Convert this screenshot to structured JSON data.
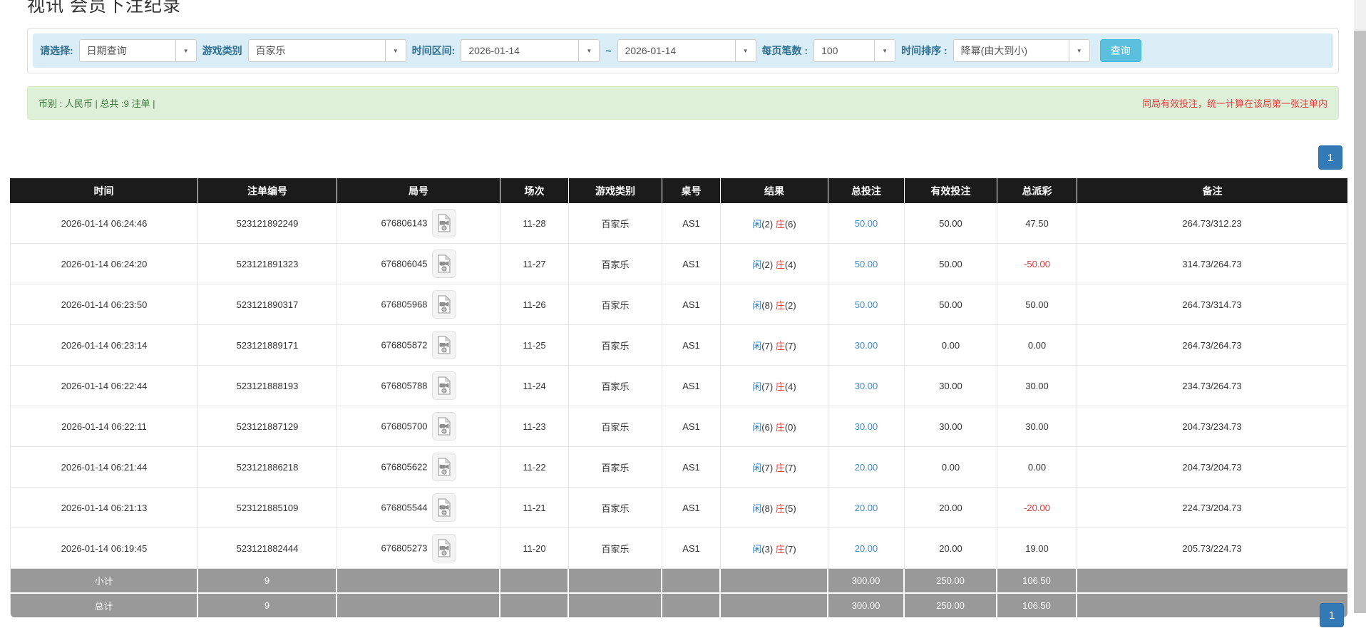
{
  "page": {
    "title": "视讯 会员下注纪录"
  },
  "filters": {
    "select_label": "请选择:",
    "select_value": "日期查询",
    "game_label": "游戏类别",
    "game_value": "百家乐",
    "range_label": "时间区间:",
    "date_from": "2026-01-14",
    "date_to": "2026-01-14",
    "tilde": "~",
    "per_page_label": "每页笔数 :",
    "per_page_value": "100",
    "sort_label": "时间排序 :",
    "sort_value": "降幂(由大到小)",
    "search_button": "查询"
  },
  "summary": {
    "left": "币别 : 人民币 | 总共 :9 注单 |",
    "right": "同局有效投注，统一计算在该局第一张注单内"
  },
  "pagination": {
    "page": "1"
  },
  "table": {
    "headers": [
      "时间",
      "注单编号",
      "局号",
      "场次",
      "游戏类别",
      "桌号",
      "结果",
      "总投注",
      "有效投注",
      "总派彩",
      "备注"
    ],
    "rows": [
      {
        "time": "2026-01-14 06:24:46",
        "bet_id": "523121892249",
        "round": "676806143",
        "session": "11-28",
        "game": "百家乐",
        "table_no": "AS1",
        "player_label": "闲",
        "player_score": "(2)",
        "banker_label": "庄",
        "banker_score": "(6)",
        "total_bet": "50.00",
        "valid_bet": "50.00",
        "payout": "47.50",
        "note": "264.73/312.23"
      },
      {
        "time": "2026-01-14 06:24:20",
        "bet_id": "523121891323",
        "round": "676806045",
        "session": "11-27",
        "game": "百家乐",
        "table_no": "AS1",
        "player_label": "闲",
        "player_score": "(2)",
        "banker_label": "庄",
        "banker_score": "(4)",
        "total_bet": "50.00",
        "valid_bet": "50.00",
        "payout": "-50.00",
        "note": "314.73/264.73"
      },
      {
        "time": "2026-01-14 06:23:50",
        "bet_id": "523121890317",
        "round": "676805968",
        "session": "11-26",
        "game": "百家乐",
        "table_no": "AS1",
        "player_label": "闲",
        "player_score": "(8)",
        "banker_label": "庄",
        "banker_score": "(2)",
        "total_bet": "50.00",
        "valid_bet": "50.00",
        "payout": "50.00",
        "note": "264.73/314.73"
      },
      {
        "time": "2026-01-14 06:23:14",
        "bet_id": "523121889171",
        "round": "676805872",
        "session": "11-25",
        "game": "百家乐",
        "table_no": "AS1",
        "player_label": "闲",
        "player_score": "(7)",
        "banker_label": "庄",
        "banker_score": "(7)",
        "total_bet": "30.00",
        "valid_bet": "0.00",
        "payout": "0.00",
        "note": "264.73/264.73"
      },
      {
        "time": "2026-01-14 06:22:44",
        "bet_id": "523121888193",
        "round": "676805788",
        "session": "11-24",
        "game": "百家乐",
        "table_no": "AS1",
        "player_label": "闲",
        "player_score": "(7)",
        "banker_label": "庄",
        "banker_score": "(4)",
        "total_bet": "30.00",
        "valid_bet": "30.00",
        "payout": "30.00",
        "note": "234.73/264.73"
      },
      {
        "time": "2026-01-14 06:22:11",
        "bet_id": "523121887129",
        "round": "676805700",
        "session": "11-23",
        "game": "百家乐",
        "table_no": "AS1",
        "player_label": "闲",
        "player_score": "(6)",
        "banker_label": "庄",
        "banker_score": "(0)",
        "total_bet": "30.00",
        "valid_bet": "30.00",
        "payout": "30.00",
        "note": "204.73/234.73"
      },
      {
        "time": "2026-01-14 06:21:44",
        "bet_id": "523121886218",
        "round": "676805622",
        "session": "11-22",
        "game": "百家乐",
        "table_no": "AS1",
        "player_label": "闲",
        "player_score": "(7)",
        "banker_label": "庄",
        "banker_score": "(7)",
        "total_bet": "20.00",
        "valid_bet": "0.00",
        "payout": "0.00",
        "note": "204.73/204.73"
      },
      {
        "time": "2026-01-14 06:21:13",
        "bet_id": "523121885109",
        "round": "676805544",
        "session": "11-21",
        "game": "百家乐",
        "table_no": "AS1",
        "player_label": "闲",
        "player_score": "(8)",
        "banker_label": "庄",
        "banker_score": "(5)",
        "total_bet": "20.00",
        "valid_bet": "20.00",
        "payout": "-20.00",
        "note": "224.73/204.73"
      },
      {
        "time": "2026-01-14 06:19:45",
        "bet_id": "523121882444",
        "round": "676805273",
        "session": "11-20",
        "game": "百家乐",
        "table_no": "AS1",
        "player_label": "闲",
        "player_score": "(3)",
        "banker_label": "庄",
        "banker_score": "(7)",
        "total_bet": "20.00",
        "valid_bet": "20.00",
        "payout": "19.00",
        "note": "205.73/224.73"
      }
    ],
    "subtotal": {
      "label": "小计",
      "count": "9",
      "total_bet": "300.00",
      "valid_bet": "250.00",
      "payout": "106.50"
    },
    "total": {
      "label": "总计",
      "count": "9",
      "total_bet": "300.00",
      "valid_bet": "250.00",
      "payout": "106.50"
    }
  },
  "icons": {
    "dropdown_arrow": "▼",
    "scroll_up_arrow": "▲",
    "video_icon_name": "video-file-icon"
  },
  "colors": {
    "filter_bar_bg": "#d9edf7",
    "filter_label": "#31708f",
    "search_button_bg": "#5bc0de",
    "summary_bg": "#dff0d8",
    "summary_text": "#3c763d",
    "warning_red": "#e4393c",
    "header_bg": "#1b1b1b",
    "link_blue": "#428bca",
    "player_blue": "#337ab7",
    "banker_red": "#e4393c",
    "sum_row_bg": "#999999",
    "pagination_active_bg": "#337ab7"
  }
}
